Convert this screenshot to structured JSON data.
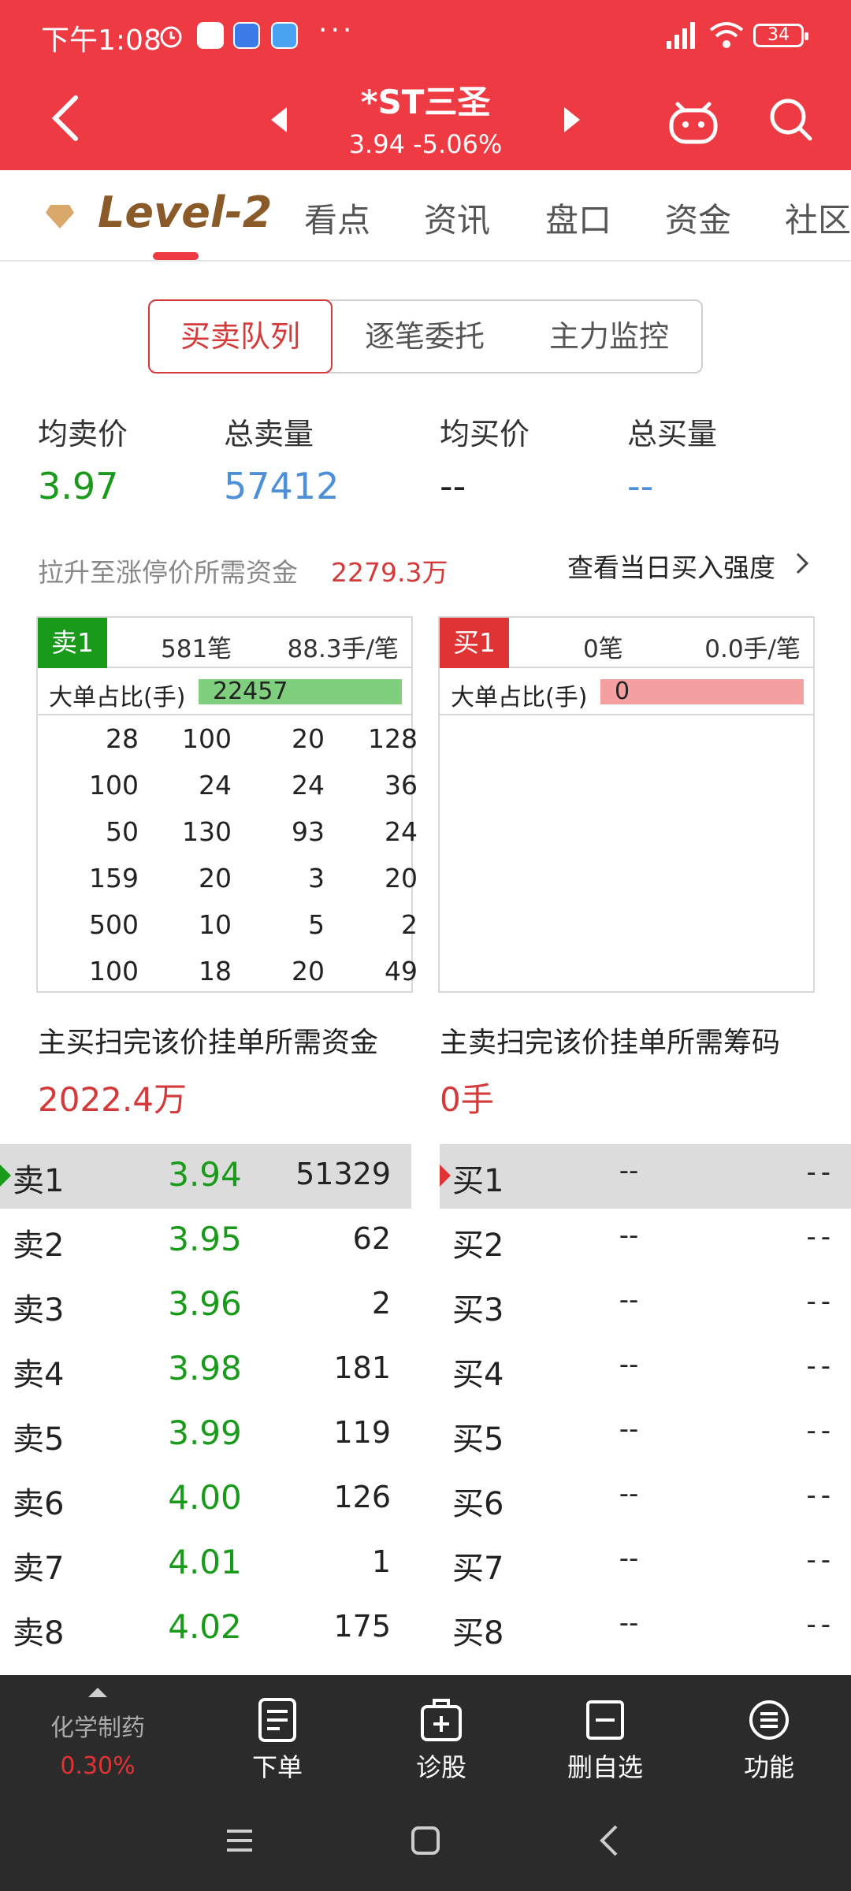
{
  "status_bar": {
    "time": "下午1:08",
    "more": "···",
    "battery": "34"
  },
  "header": {
    "stock_name": "*ST三圣",
    "price": "3.94",
    "change": "-5.06%",
    "bg_color": "#ee3a43"
  },
  "tabs": {
    "level2": "Level-2",
    "items": [
      "看点",
      "资讯",
      "盘口",
      "资金",
      "社区"
    ]
  },
  "segment": {
    "items": [
      "买卖队列",
      "逐笔委托",
      "主力监控"
    ],
    "active": "买卖队列"
  },
  "summary": {
    "avg_sell_label": "均卖价",
    "total_sell_label": "总卖量",
    "avg_buy_label": "均买价",
    "total_buy_label": "总买量",
    "avg_sell": "3.97",
    "total_sell": "57412",
    "avg_buy": "--",
    "total_buy": "--",
    "pull_label": "拉升至涨停价所需资金",
    "pull_value": "2279.3万",
    "view_link": "查看当日买入强度"
  },
  "sell_queue": {
    "tag": "卖1",
    "count": "581笔",
    "per_order": "88.3手/笔",
    "large_label": "大单占比(手)",
    "large_value": "22457",
    "large_ratio": 1.0,
    "rows": [
      [
        "28",
        "100",
        "20",
        "128"
      ],
      [
        "100",
        "24",
        "24",
        "36"
      ],
      [
        "50",
        "130",
        "93",
        "24"
      ],
      [
        "159",
        "20",
        "3",
        "20"
      ],
      [
        "500",
        "10",
        "5",
        "2"
      ],
      [
        "100",
        "18",
        "20",
        "49"
      ]
    ]
  },
  "buy_queue": {
    "tag": "买1",
    "count": "0笔",
    "per_order": "0.0手/笔",
    "large_label": "大单占比(手)",
    "large_value": "0"
  },
  "need": {
    "buy_label": "主买扫完该价挂单所需资金",
    "buy_value": "2022.4万",
    "sell_label": "主卖扫完该价挂单所需筹码",
    "sell_value": "0手"
  },
  "sell_book": [
    {
      "label": "卖1",
      "price": "3.94",
      "vol": "51329"
    },
    {
      "label": "卖2",
      "price": "3.95",
      "vol": "62"
    },
    {
      "label": "卖3",
      "price": "3.96",
      "vol": "2"
    },
    {
      "label": "卖4",
      "price": "3.98",
      "vol": "181"
    },
    {
      "label": "卖5",
      "price": "3.99",
      "vol": "119"
    },
    {
      "label": "卖6",
      "price": "4.00",
      "vol": "126"
    },
    {
      "label": "卖7",
      "price": "4.01",
      "vol": "1"
    },
    {
      "label": "卖8",
      "price": "4.02",
      "vol": "175"
    }
  ],
  "buy_book": [
    {
      "label": "买1",
      "price": "--",
      "vol": "--"
    },
    {
      "label": "买2",
      "price": "--",
      "vol": "--"
    },
    {
      "label": "买3",
      "price": "--",
      "vol": "--"
    },
    {
      "label": "买4",
      "price": "--",
      "vol": "--"
    },
    {
      "label": "买5",
      "price": "--",
      "vol": "--"
    },
    {
      "label": "买6",
      "price": "--",
      "vol": "--"
    },
    {
      "label": "买7",
      "price": "--",
      "vol": "--"
    },
    {
      "label": "买8",
      "price": "--",
      "vol": "--"
    }
  ],
  "bottom_bar": {
    "sector_name": "化学制药",
    "sector_change": "0.30%",
    "order": "下单",
    "diagnose": "诊股",
    "remove": "删自选",
    "functions": "功能"
  }
}
